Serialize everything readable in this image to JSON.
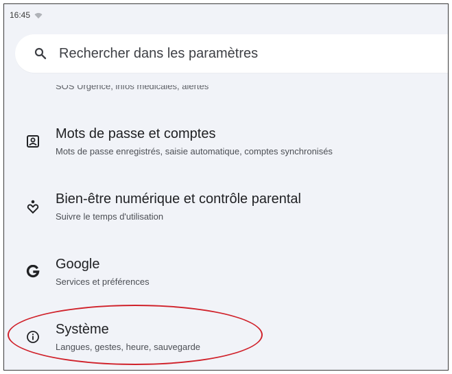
{
  "status_bar": {
    "time": "16:45",
    "wifi_icon": "wifi-icon"
  },
  "search": {
    "icon": "search-icon",
    "placeholder": "Rechercher dans les paramètres"
  },
  "partial_item": {
    "subtitle": "SOS Urgence, infos médicales, alertes"
  },
  "settings_items": [
    {
      "icon": "account-box-icon",
      "title": "Mots de passe et comptes",
      "subtitle": "Mots de passe enregistrés, saisie automatique, comptes synchronisés"
    },
    {
      "icon": "wellbeing-icon",
      "title": "Bien-être numérique et contrôle parental",
      "subtitle": "Suivre le temps d'utilisation"
    },
    {
      "icon": "google-g-icon",
      "title": "Google",
      "subtitle": "Services et préférences"
    },
    {
      "icon": "info-icon",
      "title": "Système",
      "subtitle": "Langues, gestes, heure, sauvegarde"
    }
  ],
  "annotation": {
    "highlight_color": "#d0212a"
  },
  "colors": {
    "background": "#f1f3f8",
    "surface": "#ffffff",
    "text_primary": "#202124",
    "text_secondary": "#4b4e54"
  }
}
